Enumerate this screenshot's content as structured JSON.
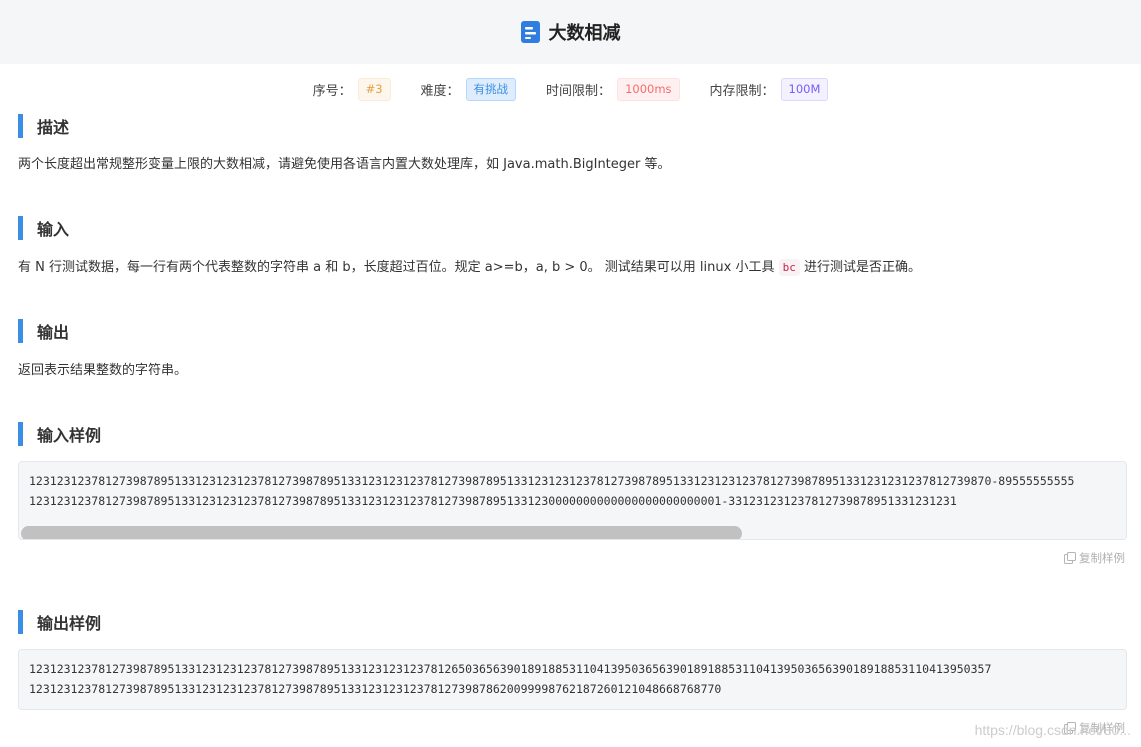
{
  "header": {
    "title": "大数相减"
  },
  "meta": {
    "id_label": "序号：",
    "id_value": "#3",
    "difficulty_label": "难度：",
    "difficulty_value": "有挑战",
    "time_label": "时间限制：",
    "time_value": "1000ms",
    "memory_label": "内存限制：",
    "memory_value": "100M"
  },
  "sections": {
    "desc_title": "描述",
    "desc_text": "两个长度超出常规整形变量上限的大数相减，请避免使用各语言内置大数处理库，如 Java.math.BigInteger 等。",
    "input_title": "输入",
    "input_text_a": "有 N 行测试数据，每一行有两个代表整数的字符串 a 和 b，长度超过百位。规定 a>=b，a, b > 0。 测试结果可以用 linux 小工具 ",
    "input_code": "bc",
    "input_text_b": " 进行测试是否正确。",
    "output_title": "输出",
    "output_text": "返回表示结果整数的字符串。",
    "sample_in_title": "输入样例",
    "sample_in_lines": [
      "1231231237812739878951331231231237812739878951331231231237812739878951331231231237812739878951331231231237812739878951331231231237812739870-89555555555",
      "1231231237812739878951331231231237812739878951331231231237812739878951331230000000000000000000000001-331231231237812739878951331231231"
    ],
    "copy_label": "复制样例",
    "sample_out_title": "输出样例",
    "sample_out_lines": [
      "1231231237812739878951331231231237812739878951331231231237812650365639018918853110413950365639018918853110413950365639018918853110413950357",
      "1231231237812739878951331231231237812739878951331231231237812739878620099998762187260121048668768770"
    ],
    "copy_label_2": "复制样例"
  },
  "watermark": "https://blog.csdn.net/u0..."
}
